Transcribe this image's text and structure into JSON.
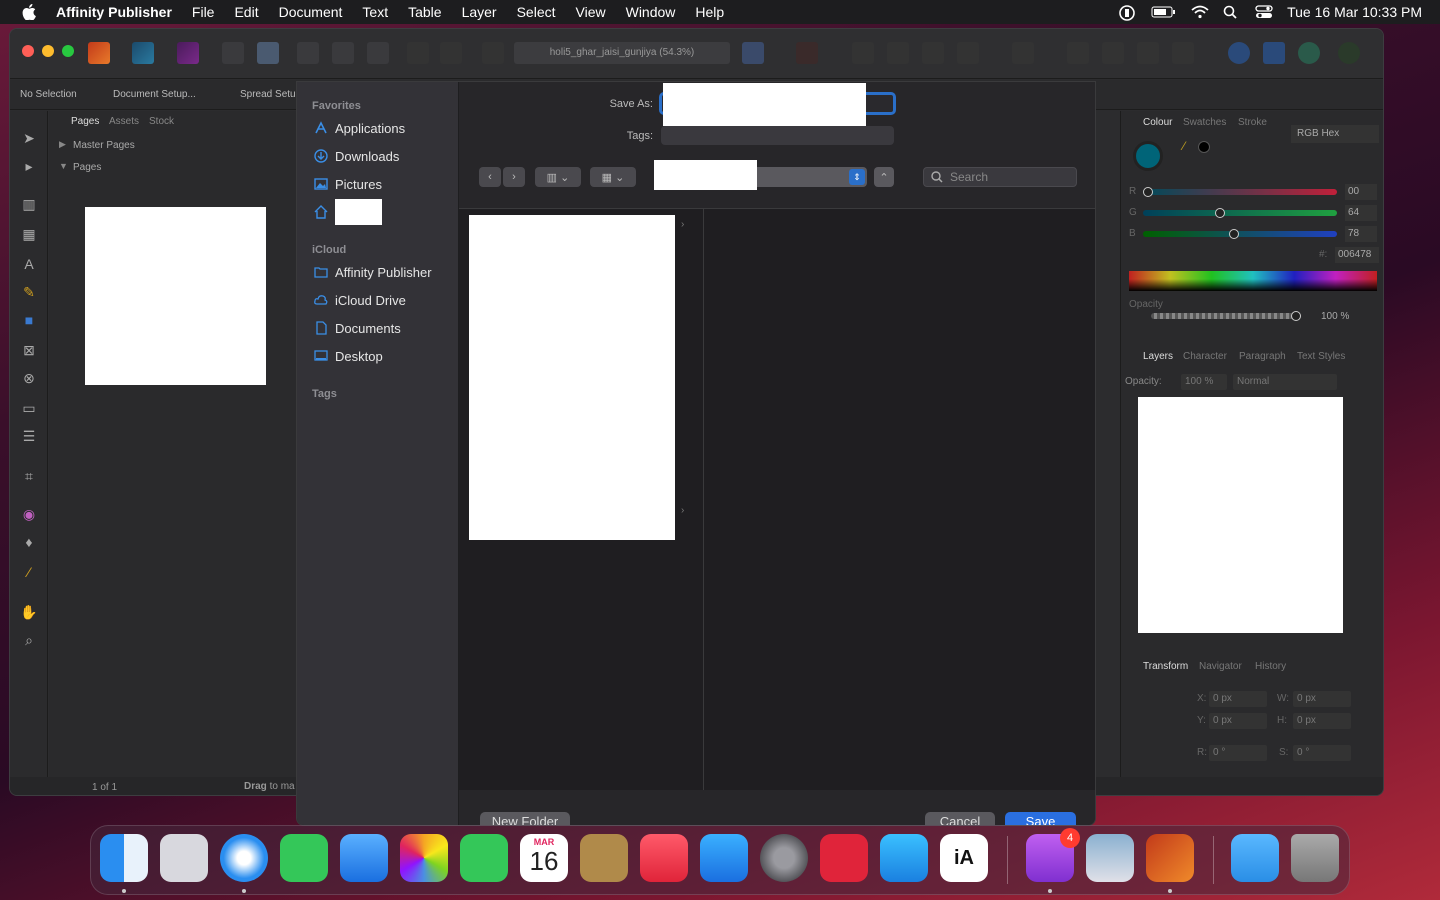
{
  "menubar": {
    "app_name": "Affinity Publisher",
    "menus": [
      "File",
      "Edit",
      "Document",
      "Text",
      "Table",
      "Layer",
      "Select",
      "View",
      "Window",
      "Help"
    ],
    "clock": "Tue 16 Mar  10:33 PM"
  },
  "window": {
    "doc_title": "holi5_ghar_jaisi_gunjiya (54.3%)",
    "context": {
      "selection": "No Selection",
      "doc_setup": "Document Setup...",
      "spread_setup": "Spread Setup"
    },
    "pages_panel": {
      "tabs": [
        "Pages",
        "Assets",
        "Stock"
      ],
      "master_pages": "Master Pages",
      "pages": "Pages"
    },
    "bottom": {
      "page_counter": "1 of 1",
      "hint_bold": "Drag",
      "hint_rest": " to ma"
    },
    "colour_panel": {
      "tabs": [
        "Colour",
        "Swatches",
        "Stroke"
      ],
      "mode": "RGB Hex",
      "r_label": "R",
      "g_label": "G",
      "b_label": "B",
      "r_value": "00",
      "g_value": "64",
      "b_value": "78",
      "r_level": 0,
      "g_level": 0.39,
      "b_level": 0.47,
      "hex_label": "#:",
      "hex_value": "006478",
      "opacity_label": "Opacity",
      "opacity_value": "100 %",
      "opacity_level": 1.0
    },
    "layers_panel": {
      "tabs": [
        "Layers",
        "Character",
        "Paragraph",
        "Text Styles"
      ],
      "opacity_label": "Opacity:",
      "opacity_value": "100 %",
      "blend": "Normal"
    },
    "transform_panel": {
      "tabs": [
        "Transform",
        "Navigator",
        "History"
      ],
      "x_label": "X:",
      "y_label": "Y:",
      "w_label": "W:",
      "h_label": "H:",
      "r_label": "R:",
      "s_label": "S:",
      "x": "0 px",
      "y": "0 px",
      "w": "0 px",
      "h": "0 px",
      "r": "0 °",
      "s": "0 °"
    }
  },
  "dialog": {
    "favorites_header": "Favorites",
    "favorites": [
      "Applications",
      "Downloads",
      "Pictures"
    ],
    "icloud_header": "iCloud",
    "icloud": [
      "Affinity Publisher",
      "iCloud Drive",
      "Documents",
      "Desktop"
    ],
    "tags_header": "Tags",
    "save_as_label": "Save As:",
    "tags_label": "Tags:",
    "search_placeholder": "Search",
    "new_folder": "New Folder",
    "cancel": "Cancel",
    "save": "Save"
  },
  "dock": {
    "calendar_month": "MAR",
    "calendar_day": "16",
    "feedback_badge": "4",
    "ia_label": "iA"
  }
}
